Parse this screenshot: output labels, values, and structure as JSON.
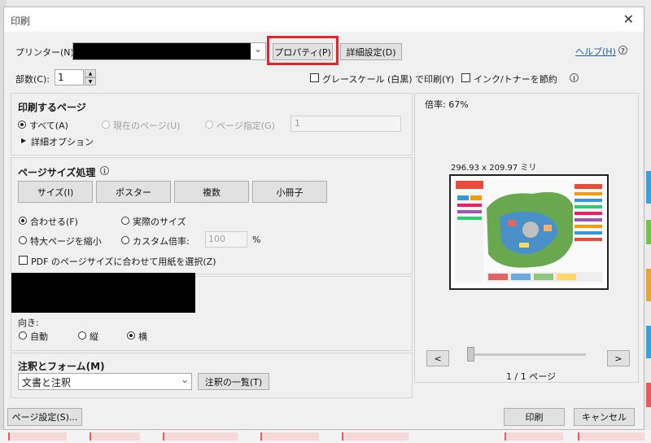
{
  "title": "印刷",
  "printer": {
    "label": "プリンター(N):",
    "properties_button": "プロパティ(P)",
    "advanced_button": "詳細設定(D)",
    "help_link": "ヘルプ(H)"
  },
  "copies": {
    "label": "部数(C):",
    "value": "1"
  },
  "grayscale": {
    "label": "グレースケール (白黒) で印刷(Y)",
    "checked": false
  },
  "ink_save": {
    "label": "インク/トナーを節約",
    "checked": false
  },
  "pages_section": {
    "title": "印刷するページ",
    "all": "すべて(A)",
    "current": "現在のページ(U)",
    "range": "ページ指定(G)",
    "range_value": "1",
    "more_options": "詳細オプション"
  },
  "size_section": {
    "title": "ページサイズ処理",
    "tabs": [
      "サイズ(I)",
      "ポスター",
      "複数",
      "小冊子"
    ],
    "fit": "合わせる(F)",
    "actual": "実際のサイズ",
    "shrink": "特大ページを縮小",
    "custom": "カスタム倍率:",
    "custom_value": "100",
    "percent": "%",
    "pdf_paper": "PDF のページサイズに合わせて用紙を選択(Z)"
  },
  "orientation": {
    "label": "向き:",
    "auto": "自動",
    "portrait": "縦",
    "landscape": "横"
  },
  "comments_section": {
    "title": "注釈とフォーム(M)",
    "selected": "文書と注釈",
    "list_button": "注釈の一覧(T)"
  },
  "preview": {
    "scale": "倍率: 67%",
    "dimensions": "296.93 x 209.97 ミリ",
    "prev": "<",
    "next": ">",
    "page_indicator": "1 / 1 ページ",
    "slider_value": 0
  },
  "footer": {
    "page_setup": "ページ設定(S)...",
    "print": "印刷",
    "cancel": "キャンセル"
  },
  "icons": {
    "close": "✕",
    "info": "i",
    "dropdown": "⌄",
    "spin_up": "▲",
    "spin_down": "▼",
    "expand": "▶"
  },
  "colors": {
    "highlight": "#e3242b",
    "link": "#2060c0"
  }
}
